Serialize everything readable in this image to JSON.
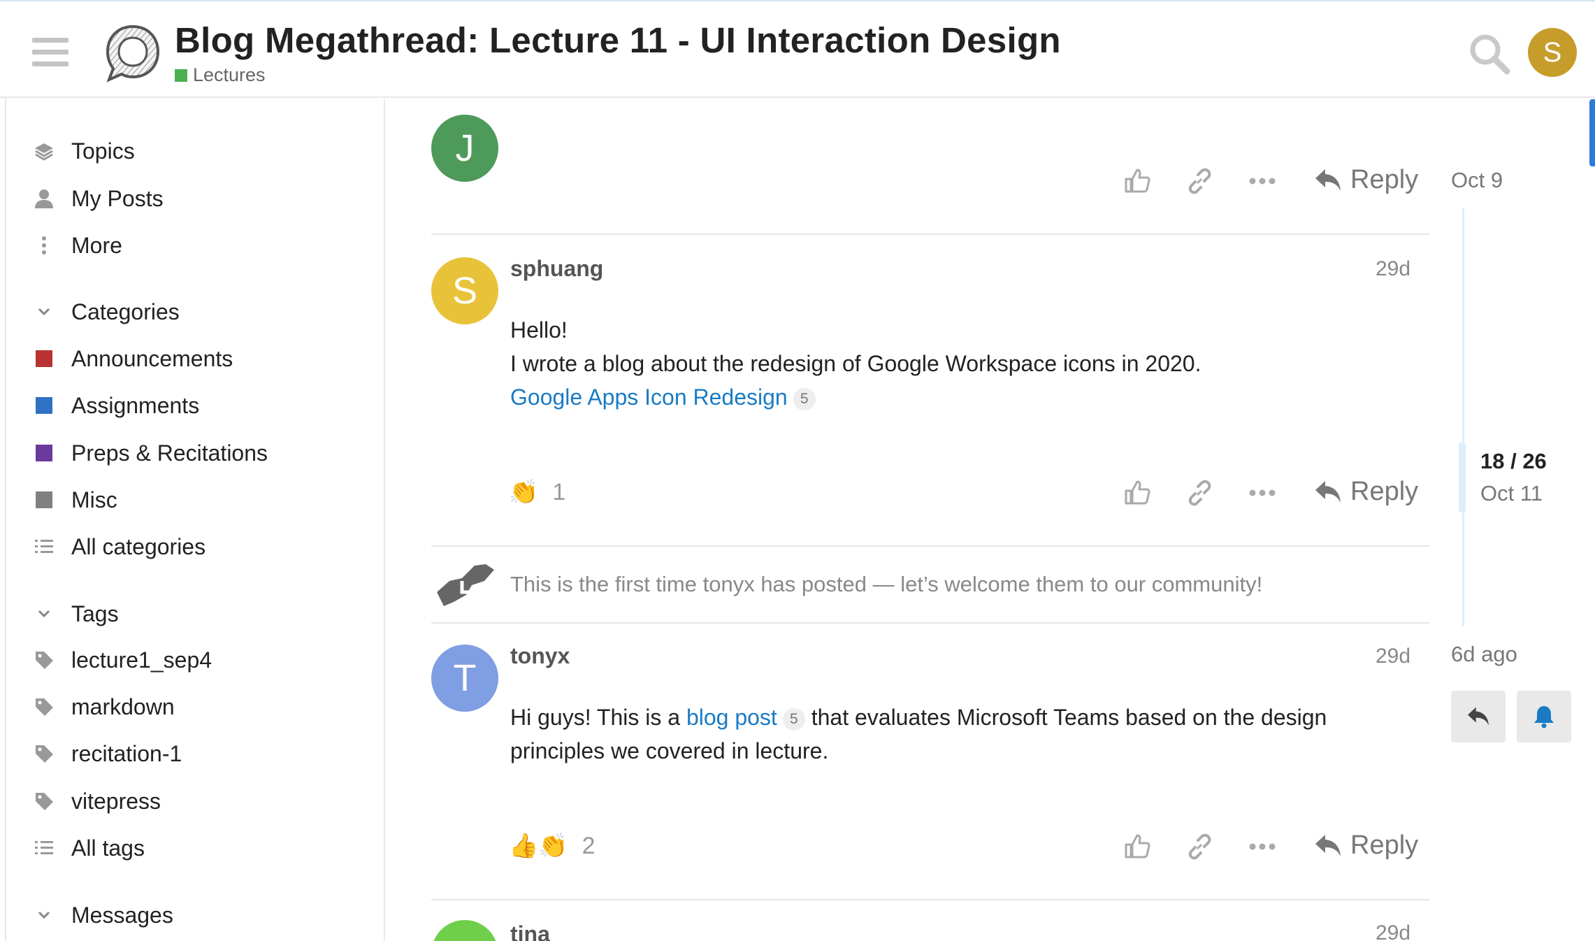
{
  "header": {
    "title": "Blog Megathread: Lecture 11 - UI Interaction Design",
    "category": "Lectures",
    "category_color": "#4caf50",
    "user_initial": "S",
    "user_avatar_color": "#c69d2b",
    "icons": [
      "hamburger-icon",
      "forum-logo",
      "search-icon"
    ]
  },
  "sidebar": {
    "nav": [
      {
        "label": "Topics",
        "icon": "layers-icon"
      },
      {
        "label": "My Posts",
        "icon": "user-icon"
      },
      {
        "label": "More",
        "icon": "vertical-ellipsis-icon"
      }
    ],
    "categories_heading": "Categories",
    "categories": [
      {
        "label": "Announcements",
        "color": "#b83232"
      },
      {
        "label": "Assignments",
        "color": "#2f72c4"
      },
      {
        "label": "Preps & Recitations",
        "color": "#6b3a9e"
      },
      {
        "label": "Misc",
        "color": "#808080"
      }
    ],
    "all_categories": "All categories",
    "tags_heading": "Tags",
    "tags": [
      "lecture1_sep4",
      "markdown",
      "recitation-1",
      "vitepress"
    ],
    "all_tags": "All tags",
    "messages_heading": "Messages"
  },
  "posts": [
    {
      "author": "",
      "initial": "J",
      "avatar_color": "#4e9a5a",
      "date": "",
      "reply_label": "Reply"
    },
    {
      "author": "sphuang",
      "initial": "S",
      "avatar_color": "#e8c33a",
      "date": "29d",
      "line1": "Hello!",
      "line2": "I wrote a blog about the redesign of Google Workspace icons in 2020.",
      "link_text": "Google Apps Icon Redesign",
      "link_clicks": "5",
      "reaction_emoji": "👏",
      "reaction_count": "1",
      "reply_label": "Reply"
    },
    {
      "small_action_text": "This is the first time tonyx has posted — let’s welcome them to our community!"
    },
    {
      "author": "tonyx",
      "initial": "T",
      "avatar_color": "#7f9ee3",
      "date": "29d",
      "text_before": "Hi guys! This is a ",
      "link_text": "blog post",
      "link_clicks": "5",
      "text_after": " that evaluates Microsoft Teams based on the design",
      "line2": "principles we covered in lecture.",
      "reaction_emoji": "👍👏",
      "reaction_count": "2",
      "reply_label": "Reply"
    },
    {
      "author": "tina",
      "initial": "",
      "avatar_color": "#6fcf4a",
      "date": "29d"
    }
  ],
  "timeline": {
    "start_date": "Oct 9",
    "position": "18 / 26",
    "position_date": "Oct 11",
    "end_label": "6d ago",
    "icons": [
      "reply-icon",
      "bell-icon"
    ]
  }
}
